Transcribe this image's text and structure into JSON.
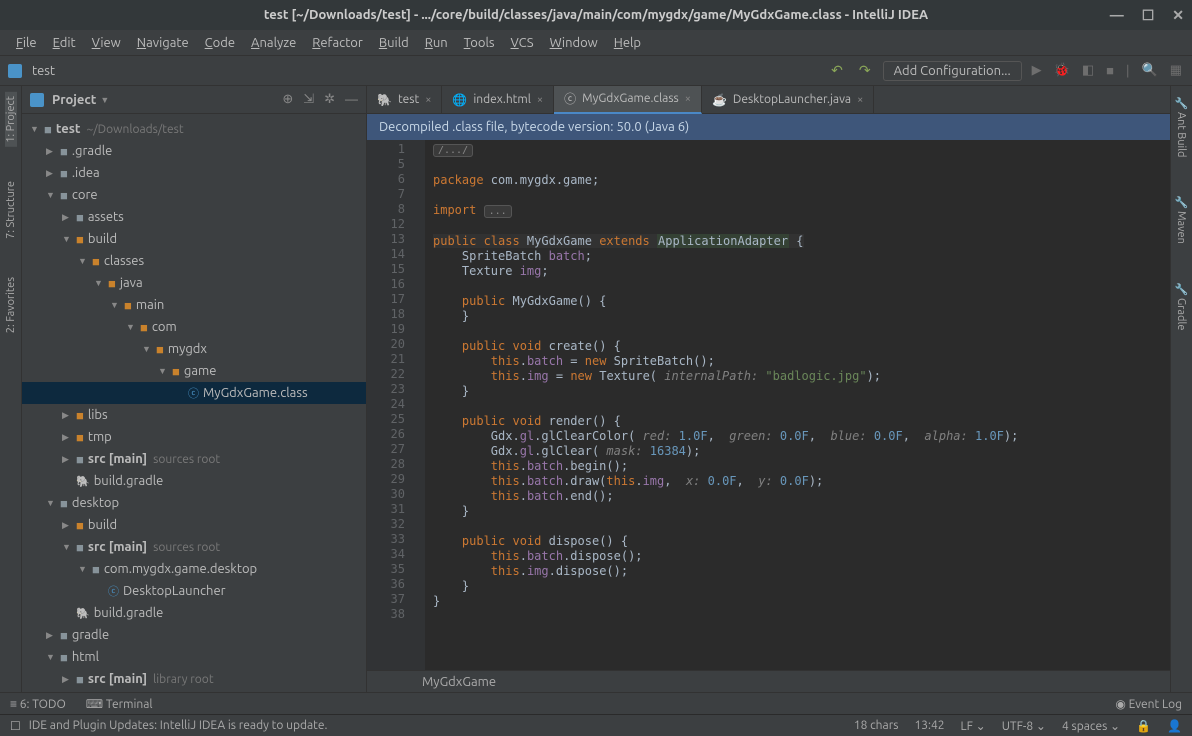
{
  "window_title": "test [~/Downloads/test] - .../core/build/classes/java/main/com/mygdx/game/MyGdxGame.class - IntelliJ IDEA",
  "menu": [
    "File",
    "Edit",
    "View",
    "Navigate",
    "Code",
    "Analyze",
    "Refactor",
    "Build",
    "Run",
    "Tools",
    "VCS",
    "Window",
    "Help"
  ],
  "breadcrumb_project": "test",
  "run_config": "Add Configuration...",
  "project_panel_title": "Project",
  "tree": {
    "root": {
      "label": "test",
      "hint": "~/Downloads/test"
    },
    "items": [
      {
        "indent": 1,
        "arrow": "▶",
        "icon": "folder",
        "label": ".gradle"
      },
      {
        "indent": 1,
        "arrow": "▶",
        "icon": "folder",
        "label": ".idea"
      },
      {
        "indent": 1,
        "arrow": "▼",
        "icon": "folder",
        "label": "core"
      },
      {
        "indent": 2,
        "arrow": "▶",
        "icon": "folder",
        "label": "assets"
      },
      {
        "indent": 2,
        "arrow": "▼",
        "icon": "folder-o",
        "label": "build"
      },
      {
        "indent": 3,
        "arrow": "▼",
        "icon": "folder-o",
        "label": "classes"
      },
      {
        "indent": 4,
        "arrow": "▼",
        "icon": "folder-o",
        "label": "java"
      },
      {
        "indent": 5,
        "arrow": "▼",
        "icon": "folder-o",
        "label": "main"
      },
      {
        "indent": 6,
        "arrow": "▼",
        "icon": "folder-o",
        "label": "com"
      },
      {
        "indent": 7,
        "arrow": "▼",
        "icon": "folder-o",
        "label": "mygdx"
      },
      {
        "indent": 8,
        "arrow": "▼",
        "icon": "folder-o",
        "label": "game"
      },
      {
        "indent": 9,
        "arrow": "",
        "icon": "class",
        "label": "MyGdxGame.class",
        "selected": true
      },
      {
        "indent": 2,
        "arrow": "▶",
        "icon": "folder-o",
        "label": "libs"
      },
      {
        "indent": 2,
        "arrow": "▶",
        "icon": "folder-o",
        "label": "tmp"
      },
      {
        "indent": 2,
        "arrow": "▶",
        "icon": "folder",
        "label": "src [main]",
        "hint": "sources root",
        "bold": true
      },
      {
        "indent": 2,
        "arrow": "",
        "icon": "gradle",
        "label": "build.gradle"
      },
      {
        "indent": 1,
        "arrow": "▼",
        "icon": "folder",
        "label": "desktop"
      },
      {
        "indent": 2,
        "arrow": "▶",
        "icon": "folder-o",
        "label": "build"
      },
      {
        "indent": 2,
        "arrow": "▼",
        "icon": "folder",
        "label": "src [main]",
        "hint": "sources root",
        "bold": true
      },
      {
        "indent": 3,
        "arrow": "▼",
        "icon": "folder",
        "label": "com.mygdx.game.desktop"
      },
      {
        "indent": 4,
        "arrow": "",
        "icon": "class",
        "label": "DesktopLauncher"
      },
      {
        "indent": 2,
        "arrow": "",
        "icon": "gradle",
        "label": "build.gradle"
      },
      {
        "indent": 1,
        "arrow": "▶",
        "icon": "folder",
        "label": "gradle"
      },
      {
        "indent": 1,
        "arrow": "▼",
        "icon": "folder",
        "label": "html"
      },
      {
        "indent": 2,
        "arrow": "▶",
        "icon": "folder",
        "label": "src [main]",
        "hint": "library root",
        "bold": true
      }
    ]
  },
  "editor_tabs": [
    {
      "icon": "gradle",
      "label": "test"
    },
    {
      "icon": "html",
      "label": "index.html"
    },
    {
      "icon": "class",
      "label": "MyGdxGame.class",
      "active": true
    },
    {
      "icon": "java",
      "label": "DesktopLauncher.java"
    }
  ],
  "notice": "Decompiled .class file, bytecode version: 50.0 (Java 6)",
  "gutter_lines": [
    "1",
    "5",
    "6",
    "7",
    "8",
    "12",
    "13",
    "14",
    "15",
    "16",
    "17",
    "18",
    "19",
    "20",
    "21",
    "22",
    "23",
    "24",
    "25",
    "26",
    "27",
    "28",
    "29",
    "30",
    "31",
    "32",
    "33",
    "34",
    "35",
    "36",
    "37",
    "38",
    ""
  ],
  "breadcrumb_editor": "MyGdxGame",
  "bottom_tools": {
    "todo": "6: TODO",
    "terminal": "Terminal",
    "eventlog": "Event Log"
  },
  "status_message": "IDE and Plugin Updates: IntelliJ IDEA is ready to update.",
  "status_right": {
    "chars": "18 chars",
    "pos": "13:42",
    "le": "LF",
    "enc": "UTF-8",
    "indent": "4 spaces"
  },
  "right_tools": [
    "Ant Build",
    "Maven",
    "Gradle"
  ],
  "left_tools": [
    "1: Project",
    "7: Structure",
    "2: Favorites"
  ]
}
